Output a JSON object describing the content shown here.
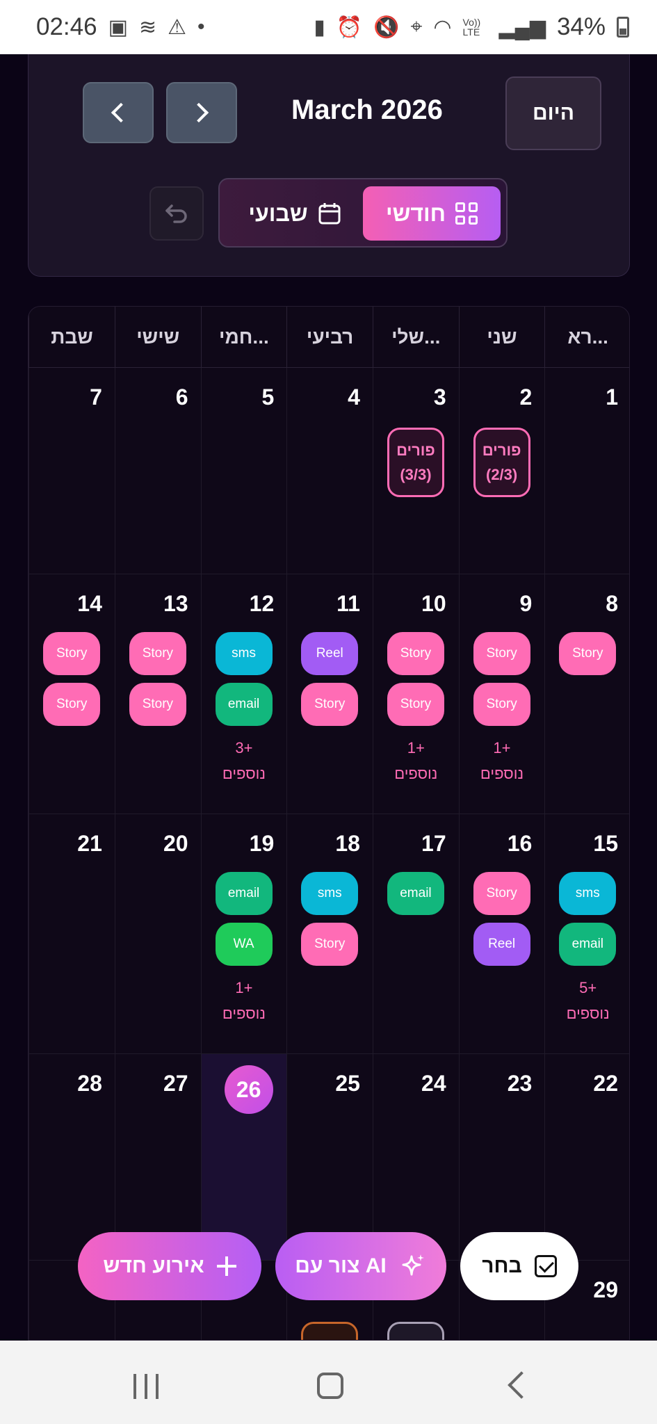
{
  "status_bar": {
    "time": "02:46",
    "left_icons": [
      "gallery-icon",
      "signal-wave-icon",
      "warning-icon",
      "dot-icon"
    ],
    "right_icons": [
      "battery-saver-icon",
      "alarm-icon",
      "mute-icon",
      "location-icon",
      "wifi-icon",
      "volte-icon",
      "signal-icon"
    ],
    "volte_label": "Vo)) LTE",
    "battery_percent": "34%"
  },
  "header": {
    "month_title": "March 2026",
    "today_label": "היום",
    "prev_icon": "chevron-left-icon",
    "next_icon": "chevron-right-icon",
    "undo_icon": "undo-icon",
    "view_monthly_label": "חודשי",
    "view_weekly_label": "שבועי",
    "active_view": "monthly"
  },
  "calendar": {
    "weekdays": [
      "רא...",
      "שני",
      "שלי...",
      "רביעי",
      "חמי...",
      "שישי",
      "שבת"
    ],
    "more_suffix": "נוספים",
    "weeks": [
      {
        "days": [
          {
            "num": "1",
            "events": []
          },
          {
            "num": "2",
            "holiday": {
              "title": "פורים",
              "part": "(2/3)"
            },
            "events": []
          },
          {
            "num": "3",
            "holiday": {
              "title": "פורים",
              "part": "(3/3)"
            },
            "events": []
          },
          {
            "num": "4",
            "events": []
          },
          {
            "num": "5",
            "events": []
          },
          {
            "num": "6",
            "events": []
          },
          {
            "num": "7",
            "events": []
          }
        ]
      },
      {
        "days": [
          {
            "num": "8",
            "events": [
              {
                "label": "Story",
                "type": "story"
              }
            ]
          },
          {
            "num": "9",
            "events": [
              {
                "label": "Story",
                "type": "story"
              },
              {
                "label": "Story",
                "type": "story"
              }
            ],
            "more": "1+"
          },
          {
            "num": "10",
            "events": [
              {
                "label": "Story",
                "type": "story"
              },
              {
                "label": "Story",
                "type": "story"
              }
            ],
            "more": "1+"
          },
          {
            "num": "11",
            "events": [
              {
                "label": "Reel",
                "type": "reel"
              },
              {
                "label": "Story",
                "type": "story"
              }
            ]
          },
          {
            "num": "12",
            "events": [
              {
                "label": "sms",
                "type": "sms"
              },
              {
                "label": "email",
                "type": "email"
              }
            ],
            "more": "3+"
          },
          {
            "num": "13",
            "events": [
              {
                "label": "Story",
                "type": "story"
              },
              {
                "label": "Story",
                "type": "story"
              }
            ]
          },
          {
            "num": "14",
            "events": [
              {
                "label": "Story",
                "type": "story"
              },
              {
                "label": "Story",
                "type": "story"
              }
            ]
          }
        ]
      },
      {
        "days": [
          {
            "num": "15",
            "events": [
              {
                "label": "sms",
                "type": "sms"
              },
              {
                "label": "email",
                "type": "email"
              }
            ],
            "more": "5+"
          },
          {
            "num": "16",
            "events": [
              {
                "label": "Story",
                "type": "story"
              },
              {
                "label": "Reel",
                "type": "reel"
              }
            ]
          },
          {
            "num": "17",
            "events": [
              {
                "label": "email",
                "type": "email"
              }
            ]
          },
          {
            "num": "18",
            "events": [
              {
                "label": "sms",
                "type": "sms"
              },
              {
                "label": "Story",
                "type": "story"
              }
            ]
          },
          {
            "num": "19",
            "events": [
              {
                "label": "email",
                "type": "email"
              },
              {
                "label": "WA",
                "type": "wa"
              }
            ],
            "more": "1+"
          },
          {
            "num": "20",
            "events": []
          },
          {
            "num": "21",
            "events": []
          }
        ]
      },
      {
        "days": [
          {
            "num": "22",
            "events": []
          },
          {
            "num": "23",
            "events": []
          },
          {
            "num": "24",
            "events": []
          },
          {
            "num": "25",
            "events": []
          },
          {
            "num": "26",
            "today": true,
            "events": []
          },
          {
            "num": "27",
            "events": []
          },
          {
            "num": "28",
            "events": []
          }
        ]
      },
      {
        "days": [
          {
            "num": "29",
            "events": []
          },
          {
            "num": "",
            "events": []
          },
          {
            "num": "",
            "peek": "gray",
            "events": []
          },
          {
            "num": "",
            "peek": "orange",
            "events": []
          },
          {
            "num": "",
            "events": []
          },
          {
            "num": "",
            "events": []
          },
          {
            "num": "",
            "events": []
          }
        ]
      }
    ]
  },
  "fabs": {
    "new_event_label": "אירוע חדש",
    "ai_label": "צור עם AI",
    "select_label": "בחר",
    "new_event_icon": "plus-icon",
    "ai_icon": "sparkle-icon",
    "select_icon": "checkbox-icon"
  },
  "nav_bar": {
    "icons": [
      "recent-apps-icon",
      "home-icon",
      "back-icon"
    ]
  },
  "colors": {
    "background": "#0b0416",
    "story": "#ff6cb5",
    "reel": "#a25cf4",
    "sms": "#0ab7d6",
    "email": "#12b77d",
    "wa": "#1fcb5a",
    "accent_gradient_start": "#f45fb4",
    "accent_gradient_end": "#b65ef2"
  }
}
